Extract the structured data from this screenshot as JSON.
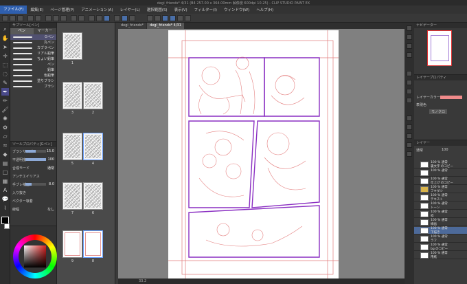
{
  "app": {
    "title": "degi_friends* 4/31 (B4 257.00 x 364.00mm 解像度 600dpi 10.25) - CLIP STUDIO PAINT EX"
  },
  "menu": [
    "ファイル(F)",
    "編集(E)",
    "ページ管理(P)",
    "アニメーション(A)",
    "レイヤー(L)",
    "選択範囲(S)",
    "表示(V)",
    "フィルター(I)",
    "ウィンドウ(W)",
    "ヘルプ(H)"
  ],
  "subtool": {
    "header": "サブツール[ペン]",
    "tabs": [
      "ペン",
      "マーカー"
    ],
    "brushes": [
      "Gペン",
      "丸ペン",
      "カブラペン",
      "リアル鉛筆",
      "ちょい鉛筆",
      "ペン",
      "鉛筆",
      "色鉛筆",
      "塗りブラシ",
      "ブラシ"
    ]
  },
  "toolprop": {
    "header": "ツールプロパティ[Gペン]",
    "rows": [
      {
        "label": "ブラシサイズ",
        "value": "15.0",
        "fill": 0.5
      },
      {
        "label": "不透明度",
        "value": "100",
        "fill": 1.0
      },
      {
        "label": "合成モード",
        "value": "通常",
        "fill": 0
      },
      {
        "label": "アンチエイリアス",
        "value": "",
        "fill": 0
      },
      {
        "label": "手ブレ補正",
        "value": "8.0",
        "fill": 0.3
      },
      {
        "label": "入り抜き",
        "value": "",
        "fill": 0
      },
      {
        "label": "ベクター吸着",
        "value": "",
        "fill": 0
      },
      {
        "label": "線幅",
        "value": "なし",
        "fill": 0
      }
    ]
  },
  "pages": {
    "labels": [
      "1",
      "3",
      "2",
      "5",
      "4",
      "7",
      "6",
      "9",
      "8"
    ]
  },
  "doc_tabs": [
    "degi_friends*",
    "degi_friends* 4/31"
  ],
  "canvas": {
    "zoom": "33.2"
  },
  "navigator": {
    "header": "ナビゲーター"
  },
  "layerprop": {
    "header": "レイヤープロパティ",
    "effect_label": "レイヤーカラー",
    "color_label": "表現色",
    "color_value": "モノクロ",
    "accent_color": "#f08a8a"
  },
  "layers": {
    "header": "レイヤー",
    "blend": "通常",
    "opacity": "100",
    "items": [
      {
        "line1": "100 % 通常",
        "line2": "裏文字 のコピー"
      },
      {
        "line1": "100 % 通常",
        "line2": ""
      },
      {
        "line1": "100 % 通常",
        "line2": "仕上げ のコピー"
      },
      {
        "line1": "100 % 通常",
        "line2": "フキダシ"
      },
      {
        "line1": "100 % 通常",
        "line2": "テキスト"
      },
      {
        "line1": "100 % 通常",
        "line2": "トーン"
      },
      {
        "line1": "100 % 通常",
        "line2": "枠"
      },
      {
        "line1": "100 % 通常",
        "line2": "線画"
      },
      {
        "line1": "100 % 通常",
        "line2": "下描き"
      },
      {
        "line1": "100 % 通常",
        "line2": "ラフ"
      },
      {
        "line1": "100 % 通常",
        "line2": "bg のコピー"
      },
      {
        "line1": "100 % 通常",
        "line2": "用紙"
      }
    ]
  }
}
